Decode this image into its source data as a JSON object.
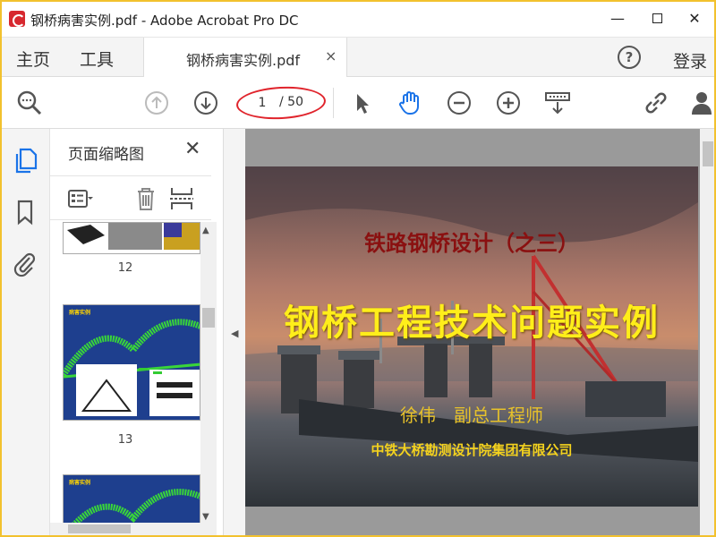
{
  "window": {
    "title": "钢桥病害实例.pdf - Adobe Acrobat Pro DC",
    "minimize": "—",
    "close": "✕"
  },
  "tabs": {
    "home": "主页",
    "tools": "工具",
    "document": "钢桥病害实例.pdf",
    "document_close": "×",
    "login": "登录"
  },
  "toolbar": {
    "page_current": "1",
    "page_total": "/ 50"
  },
  "thumbnails": {
    "title": "页面缩略图",
    "close": "✕",
    "pages": [
      {
        "label": "12"
      },
      {
        "label": "13",
        "heading": "病害实例"
      },
      {
        "heading": "病害实例"
      }
    ]
  },
  "slide": {
    "subtitle": "铁路钢桥设计（之三）",
    "title": "钢桥工程技术问题实例",
    "author": "徐伟　副总工程师",
    "organization": "中铁大桥勘测设计院集团有限公司"
  },
  "colors": {
    "accent_blue": "#1a73e8",
    "annotation_red": "#e0242c",
    "frame_yellow": "#f2c12e"
  }
}
